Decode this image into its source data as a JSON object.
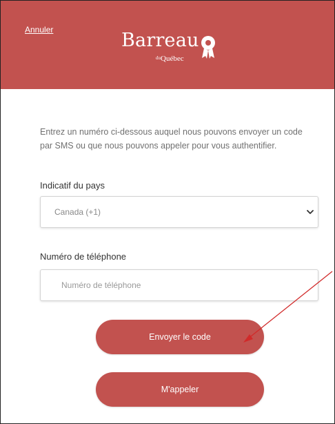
{
  "header": {
    "cancel_label": "Annuler",
    "brand_name": "Barreau",
    "brand_prefix": "du",
    "brand_sub": "Québec",
    "background_color": "#c2524f"
  },
  "form": {
    "intro_text": "Entrez un numéro ci-dessous auquel nous pouvons envoyer un code par SMS ou que nous pouvons appeler pour vous authentifier.",
    "country_label": "Indicatif du pays",
    "country_selected": "Canada (+1)",
    "phone_label": "Numéro de téléphone",
    "phone_placeholder": "Numéro de téléphone",
    "phone_value": ""
  },
  "buttons": {
    "send_code_label": "Envoyer le code",
    "call_me_label": "M'appeler",
    "color": "#c2524f"
  },
  "annotation": {
    "arrow_color": "#d12a2a"
  },
  "icons": {
    "seal": "barreau-seal-icon",
    "chevron": "chevron-down-icon"
  }
}
